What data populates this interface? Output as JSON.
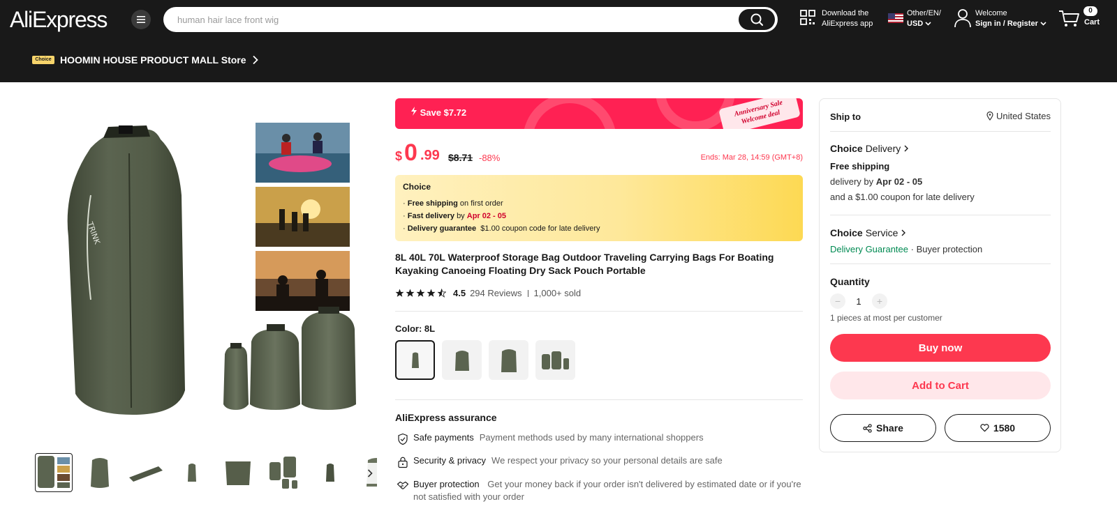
{
  "header": {
    "logo": "AliExpress",
    "search_placeholder": "human hair lace front wig",
    "download_line1": "Download the",
    "download_line2": "AliExpress app",
    "lang_line1": "Other/EN/",
    "lang_line2": "USD",
    "welcome_line1": "Welcome",
    "welcome_line2": "Sign in / Register",
    "cart_count": "0",
    "cart_label": "Cart"
  },
  "store": {
    "badge": "Choice",
    "name": "HOOMIN HOUSE PRODUCT MALL Store"
  },
  "promo": {
    "save": "Save $7.72",
    "anniversary_line1": "Anniversary Sale",
    "anniversary_line2": "Welcome deal"
  },
  "price": {
    "currency": "$",
    "integer": "0",
    "decimal": ".99",
    "original": "$8.71",
    "discount": "-88%",
    "ends": "Ends: Mar 28, 14:59 (GMT+8)"
  },
  "choice": {
    "title": "Choice",
    "free_label": "Free shipping",
    "free_text": "on first order",
    "fast_label": "Fast delivery",
    "fast_by": "by",
    "fast_date": "Apr 02 - 05",
    "guarantee_label": "Delivery guarantee",
    "guarantee_text": "$1.00 coupon code for late delivery"
  },
  "product": {
    "title": "8L 40L 70L Waterproof Storage Bag Outdoor Traveling Carrying Bags For Boating Kayaking Canoeing Floating Dry Sack Pouch Portable",
    "rating": "4.5",
    "reviews": "294 Reviews",
    "sold": "1,000+ sold",
    "color_label": "Color: 8L"
  },
  "assurance": {
    "title": "AliExpress assurance",
    "items": [
      {
        "label": "Safe payments",
        "desc": "Payment methods used by many international shoppers"
      },
      {
        "label": "Security & privacy",
        "desc": "We respect your privacy so your personal details are safe"
      },
      {
        "label": "Buyer protection",
        "desc": "Get your money back if your order isn't delivered by estimated date or if you're not satisfied with your order"
      }
    ]
  },
  "side": {
    "ship_to": "Ship to",
    "location": "United States",
    "delivery_choice": "Choice",
    "delivery_label": "Delivery",
    "free_shipping": "Free shipping",
    "delivery_by": "delivery by",
    "delivery_date": "Apr 02 - 05",
    "coupon_note": "and a $1.00 coupon for late delivery",
    "service_choice": "Choice",
    "service_label": "Service",
    "guarantee": "Delivery Guarantee",
    "protection": "· Buyer protection",
    "quantity_label": "Quantity",
    "quantity_value": "1",
    "limit": "1 pieces at most per customer",
    "buy_now": "Buy now",
    "add_to_cart": "Add to Cart",
    "share": "Share",
    "wishlist_count": "1580"
  },
  "colors": {
    "accent": "#fd384f",
    "header_bg": "#191919",
    "green": "#008a52"
  }
}
